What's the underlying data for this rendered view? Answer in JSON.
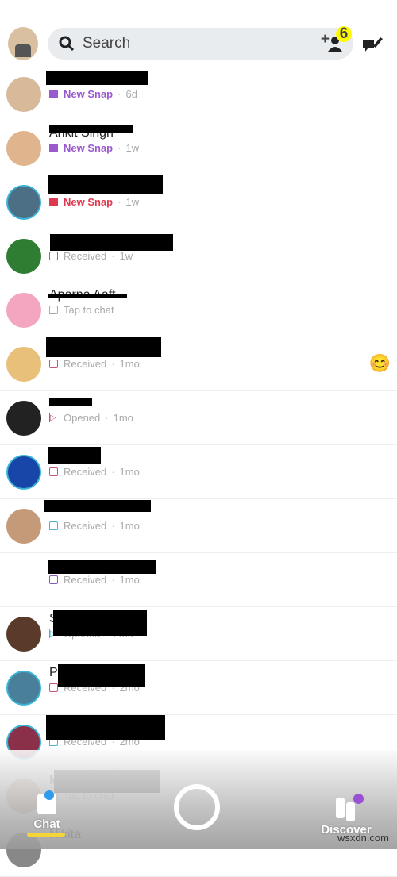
{
  "header": {
    "search_placeholder": "Search",
    "friend_requests_count": "6",
    "add_friend_label": "+"
  },
  "colors": {
    "purple": "#9b59d0",
    "red": "#e0384f",
    "received_red": "#c5567a",
    "blue": "#4fb3d9",
    "purple_outline": "#8a5cc0",
    "gray": "#aaaaaa",
    "yellow": "#f5d43a"
  },
  "chats": [
    {
      "name": "",
      "status": "New Snap",
      "time": "6d",
      "icon": "filled-square",
      "color": "#9b59d0",
      "highlight": true
    },
    {
      "name": "Ankit Singh",
      "status": "New Snap",
      "time": "1w",
      "icon": "filled-square",
      "color": "#9b59d0",
      "highlight": true
    },
    {
      "name": "",
      "status": "New Snap",
      "time": "1w",
      "icon": "filled-square",
      "color": "#e0384f",
      "highlight": true
    },
    {
      "name": "",
      "status": "Received",
      "time": "1w",
      "icon": "outline-square",
      "color": "#c5567a"
    },
    {
      "name": "Aparna Aaft",
      "status": "Tap to chat",
      "time": "",
      "icon": "chat-outline",
      "color": "#aaaaaa"
    },
    {
      "name": "",
      "status": "Received",
      "time": "1mo",
      "icon": "outline-square",
      "color": "#c5567a",
      "emoji": "😊"
    },
    {
      "name": "",
      "status": "Opened",
      "time": "1mo",
      "icon": "arrow-outline",
      "color": "#c5567a"
    },
    {
      "name": "",
      "status": "Received",
      "time": "1mo",
      "icon": "outline-square",
      "color": "#c5567a"
    },
    {
      "name": "",
      "status": "Received",
      "time": "1mo",
      "icon": "chat-outline",
      "color": "#4fb3d9"
    },
    {
      "name": "",
      "status": "Received",
      "time": "1mo",
      "icon": "outline-square",
      "color": "#8a5cc0"
    },
    {
      "name": "S",
      "status": "Opened",
      "time": "2mo",
      "icon": "arrow-outline",
      "color": "#4fb3d9"
    },
    {
      "name": "P",
      "status": "Received",
      "time": "2mo",
      "icon": "outline-square",
      "color": "#c5567a"
    },
    {
      "name": "",
      "status": "Received",
      "time": "2mo",
      "icon": "chat-outline",
      "color": "#4fb3d9"
    },
    {
      "name": "M",
      "status": "Tap to chat",
      "time": "",
      "icon": "chat-outline",
      "color": "#aaaaaa"
    },
    {
      "name": "Nikita",
      "status": "",
      "time": "",
      "icon": "",
      "color": "#aaaaaa"
    }
  ],
  "nav": {
    "chat_label": "Chat",
    "discover_label": "Discover"
  },
  "watermark": "wsxdn.com"
}
